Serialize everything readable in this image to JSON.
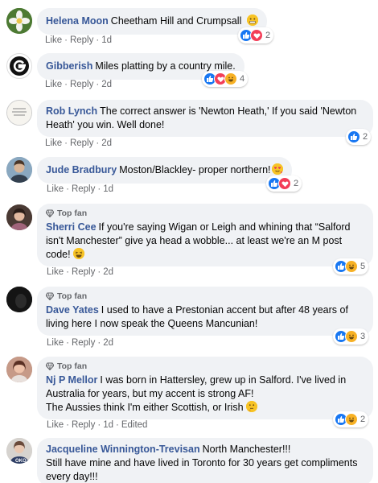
{
  "labels": {
    "like": "Like",
    "reply": "Reply",
    "sep": "·",
    "top_fan": "Top fan",
    "edited": "Edited"
  },
  "comments": [
    {
      "name": "Helena Moon",
      "text": "Cheetham Hill and Crumpsall",
      "time": "1d",
      "react_count": "2",
      "reactions": [
        "like",
        "love"
      ],
      "avatar": "flower-avatar"
    },
    {
      "name": "Gibberish",
      "text": "Miles platting by a country mile.",
      "time": "2d",
      "react_count": "4",
      "reactions": [
        "like",
        "love",
        "haha"
      ],
      "avatar": "g-logo-avatar"
    },
    {
      "name": "Rob Lynch",
      "text": "The correct answer is 'Newton Heath,' If you said 'Newton Heath' you win. Well done!",
      "time": "2d",
      "react_count": "2",
      "reactions": [
        "like"
      ],
      "avatar": "text-image-avatar"
    },
    {
      "name": "Jude Bradbury",
      "text": "Moston/Blackley- proper northern!",
      "time": "1d",
      "react_count": "2",
      "reactions": [
        "like",
        "love"
      ],
      "avatar": "person-avatar"
    },
    {
      "name": "Sherri Cee",
      "text": "If you're saying Wigan or Leigh and whining that “Salford isn't Manchester” give ya head a wobble... at least we're an M post code!",
      "time": "2d",
      "react_count": "5",
      "reactions": [
        "like",
        "haha"
      ],
      "avatar": "person-avatar",
      "top_fan": true
    },
    {
      "name": "Dave Yates",
      "text": "I used to have a Prestonian accent but after 48 years of living here I now speak the Queens Mancunian!",
      "time": "2d",
      "react_count": "3",
      "reactions": [
        "like",
        "haha"
      ],
      "avatar": "person-avatar",
      "top_fan": true
    },
    {
      "name": "Nj P Mellor",
      "text1": "I was born in Hattersley, grew up in Salford. I've lived in Australia for years, but my accent is strong AF!",
      "text2": "The Aussies think I'm either Scottish, or Irish",
      "time": "1d",
      "react_count": "2",
      "reactions": [
        "like",
        "haha"
      ],
      "avatar": "person-avatar",
      "top_fan": true
    },
    {
      "name": "Jacqueline Winnington-Trevisan",
      "text1": "North Manchester!!!",
      "text2": "Still have mine and have lived in Toronto for 30 years get compliments every day!!!",
      "avatar": "person-avatar"
    }
  ],
  "colors": {
    "name": "#385898",
    "bubble": "#f0f2f5",
    "like": "#1877f2",
    "love": "#f33e58",
    "haha": "#f7b125",
    "meta": "#65676b"
  }
}
